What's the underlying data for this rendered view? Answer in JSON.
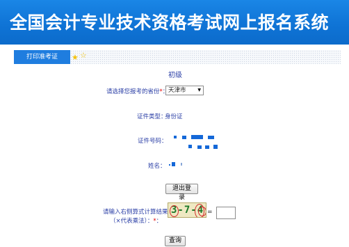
{
  "header": {
    "title": "全国会计专业技术资格考试网上报名系统"
  },
  "tabs": [
    {
      "label": "打印准考证"
    }
  ],
  "level": "初级",
  "province": {
    "label": "请选择您报考的省份",
    "required_mark": "*",
    "colon": "：",
    "selected": "天津市"
  },
  "id_type": {
    "label": "证件类型：",
    "value": "身份证"
  },
  "id_number": {
    "label": "证件号码："
  },
  "name_field": {
    "label": "姓名："
  },
  "buttons": {
    "logout": "退出登录",
    "query": "查询"
  },
  "captcha": {
    "prompt_line1": "请输入右侧算式计算结果",
    "prompt_line2_prefix": "（×代表乘法）：",
    "required_mark": "*",
    "colon": "：",
    "image_text": "3-7-4",
    "equals": "="
  },
  "colors": {
    "banner": "#1a86e6",
    "tab": "#1f7ddf",
    "label": "#2b3fa6",
    "required": "#e00000",
    "mask": "#1468d8"
  },
  "icons": [
    "star-icon",
    "star-icon",
    "chevron-down-icon"
  ]
}
